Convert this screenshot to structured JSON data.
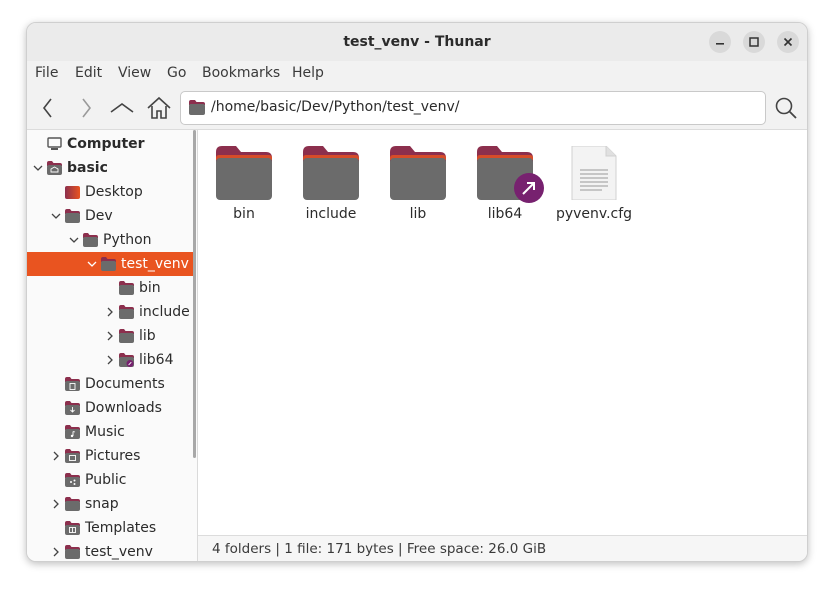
{
  "window": {
    "title": "test_venv - Thunar"
  },
  "menubar": {
    "items": [
      "File",
      "Edit",
      "View",
      "Go",
      "Bookmarks",
      "Help"
    ]
  },
  "toolbar": {
    "location_path": "/home/basic/Dev/Python/test_venv/"
  },
  "sidebar": {
    "items": [
      {
        "label": "Computer",
        "bold": true
      },
      {
        "label": "basic",
        "bold": true
      },
      {
        "label": "Desktop"
      },
      {
        "label": "Dev"
      },
      {
        "label": "Python"
      },
      {
        "label": "test_venv",
        "selected": true
      },
      {
        "label": "bin"
      },
      {
        "label": "include"
      },
      {
        "label": "lib"
      },
      {
        "label": "lib64"
      },
      {
        "label": "Documents"
      },
      {
        "label": "Downloads"
      },
      {
        "label": "Music"
      },
      {
        "label": "Pictures"
      },
      {
        "label": "Public"
      },
      {
        "label": "snap"
      },
      {
        "label": "Templates"
      },
      {
        "label": "test_venv"
      }
    ]
  },
  "files": [
    {
      "name": "bin",
      "type": "folder"
    },
    {
      "name": "include",
      "type": "folder"
    },
    {
      "name": "lib",
      "type": "folder"
    },
    {
      "name": "lib64",
      "type": "folder-link"
    },
    {
      "name": "pyvenv.cfg",
      "type": "text-file"
    }
  ],
  "statusbar": {
    "text": "4 folders | 1 file: 171 bytes | Free space: 26.0 GiB"
  },
  "colors": {
    "accent": "#e95420",
    "folder_tab": "#8c2f4d",
    "folder_body": "#6b6b6b",
    "link_badge": "#77216f"
  }
}
